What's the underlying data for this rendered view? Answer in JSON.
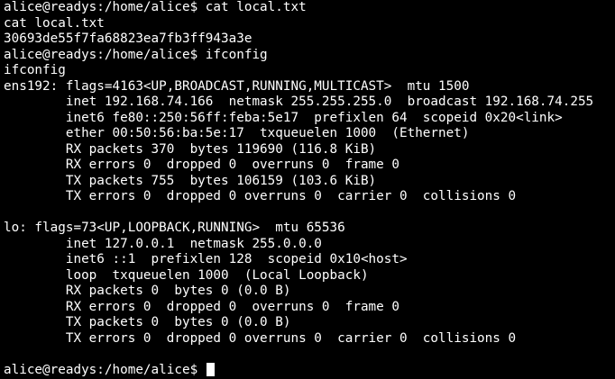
{
  "terminal": {
    "lines": [
      "alice@readys:/home/alice$ cat local.txt",
      "cat local.txt",
      "30693de55f7fa68823ea7fb3ff943a3e",
      "alice@readys:/home/alice$ ifconfig",
      "ifconfig",
      "ens192: flags=4163<UP,BROADCAST,RUNNING,MULTICAST>  mtu 1500",
      "        inet 192.168.74.166  netmask 255.255.255.0  broadcast 192.168.74.255",
      "        inet6 fe80::250:56ff:feba:5e17  prefixlen 64  scopeid 0x20<link>",
      "        ether 00:50:56:ba:5e:17  txqueuelen 1000  (Ethernet)",
      "        RX packets 370  bytes 119690 (116.8 KiB)",
      "        RX errors 0  dropped 0  overruns 0  frame 0",
      "        TX packets 755  bytes 106159 (103.6 KiB)",
      "        TX errors 0  dropped 0 overruns 0  carrier 0  collisions 0",
      "",
      "lo: flags=73<UP,LOOPBACK,RUNNING>  mtu 65536",
      "        inet 127.0.0.1  netmask 255.0.0.0",
      "        inet6 ::1  prefixlen 128  scopeid 0x10<host>",
      "        loop  txqueuelen 1000  (Local Loopback)",
      "        RX packets 0  bytes 0 (0.0 B)",
      "        RX errors 0  dropped 0  overruns 0  frame 0",
      "        TX packets 0  bytes 0 (0.0 B)",
      "        TX errors 0  dropped 0 overruns 0  carrier 0  collisions 0",
      "",
      "alice@readys:/home/alice$ "
    ],
    "background": "#000000",
    "foreground": "#ffffff"
  }
}
